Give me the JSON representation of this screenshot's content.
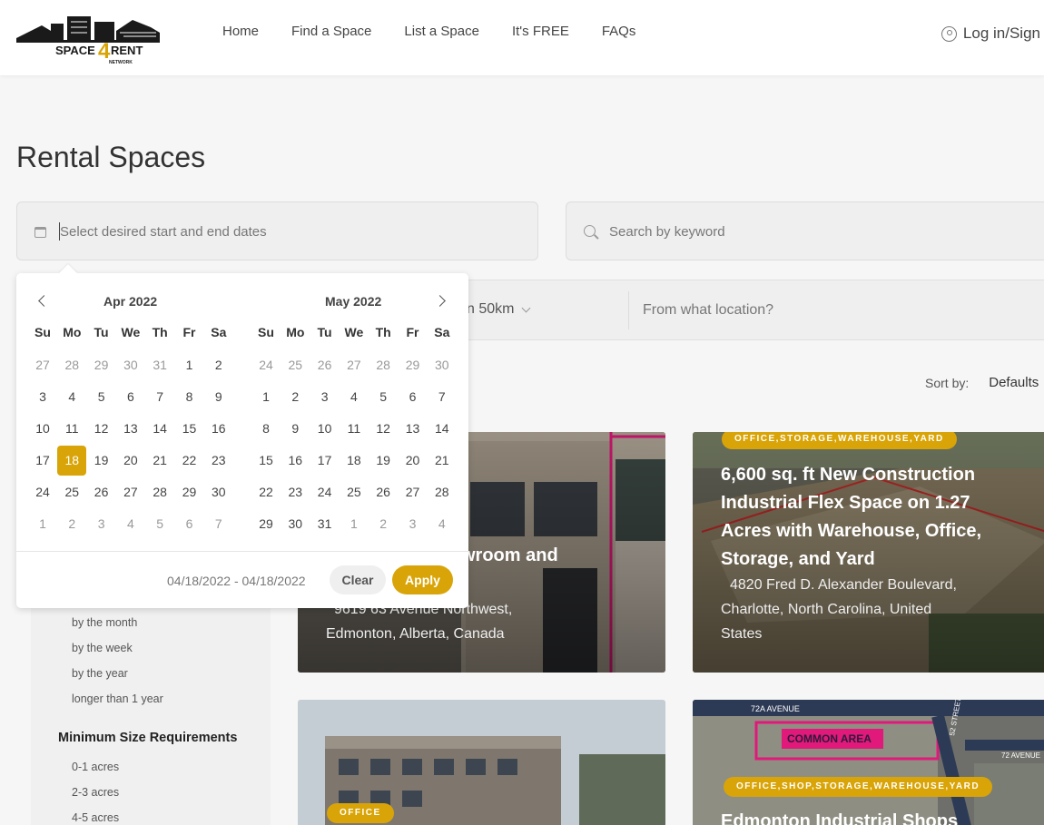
{
  "brand": {
    "name": "SPACE 4 RENT",
    "sub": "NETWORK",
    "accent": "#d9a407"
  },
  "nav": [
    {
      "label": "Home"
    },
    {
      "label": "Find a Space"
    },
    {
      "label": "List a Space"
    },
    {
      "label": "It's FREE"
    },
    {
      "label": "FAQs"
    }
  ],
  "login_label": "Log in/Sign",
  "page_title": "Rental Spaces",
  "date_field": {
    "placeholder": "Select desired start and end dates"
  },
  "search": {
    "placeholder": "Search by keyword"
  },
  "filters": {
    "radius": "n 50km",
    "location_placeholder": "From what location?"
  },
  "sort": {
    "label": "Sort by:",
    "value": "Defaults"
  },
  "calendar": {
    "weekdays": [
      "Su",
      "Mo",
      "Tu",
      "We",
      "Th",
      "Fr",
      "Sa"
    ],
    "months": [
      {
        "title": "Apr 2022",
        "weeks": [
          [
            "27",
            "28",
            "29",
            "30",
            "31",
            "1",
            "2"
          ],
          [
            "3",
            "4",
            "5",
            "6",
            "7",
            "8",
            "9"
          ],
          [
            "10",
            "11",
            "12",
            "13",
            "14",
            "15",
            "16"
          ],
          [
            "17",
            "18",
            "19",
            "20",
            "21",
            "22",
            "23"
          ],
          [
            "24",
            "25",
            "26",
            "27",
            "28",
            "29",
            "30"
          ],
          [
            "1",
            "2",
            "3",
            "4",
            "5",
            "6",
            "7"
          ]
        ],
        "selected": "18"
      },
      {
        "title": "May 2022",
        "weeks": [
          [
            "24",
            "25",
            "26",
            "27",
            "28",
            "29",
            "30"
          ],
          [
            "1",
            "2",
            "3",
            "4",
            "5",
            "6",
            "7"
          ],
          [
            "8",
            "9",
            "10",
            "11",
            "12",
            "13",
            "14"
          ],
          [
            "15",
            "16",
            "17",
            "18",
            "19",
            "20",
            "21"
          ],
          [
            "22",
            "23",
            "24",
            "25",
            "26",
            "27",
            "28"
          ],
          [
            "29",
            "30",
            "31",
            "1",
            "2",
            "3",
            "4"
          ]
        ],
        "selected": ""
      }
    ],
    "range_text": "04/18/2022 - 04/18/2022",
    "clear_label": "Clear",
    "apply_label": "Apply"
  },
  "sidebar": {
    "duration_options": [
      "by the month",
      "by the week",
      "by the year",
      "longer than 1 year"
    ],
    "size_heading": "Minimum Size Requirements",
    "size_options": [
      "0-1 acres",
      "2-3 acres",
      "4-5 acres"
    ]
  },
  "listings": [
    {
      "title": "wroom and",
      "address_line1": "9619 63 Avenue Northwest,",
      "address_line2": "Edmonton, Alberta, Canada",
      "badge": ""
    },
    {
      "badge": "OFFICE,STORAGE,WAREHOUSE,YARD",
      "title_lines": [
        "6,600 sq. ft New Construction",
        "Industrial Flex Space on 1.27",
        "Acres with Warehouse, Office,",
        "Storage, and Yard"
      ],
      "address_lines": [
        "4820 Fred D. Alexander Boulevard,",
        "Charlotte, North Carolina, United",
        "States"
      ]
    },
    {
      "badge": "OFFICE"
    },
    {
      "badge": "OFFICE,SHOP,STORAGE,WAREHOUSE,YARD",
      "title": "Edmonton Industrial Shops",
      "map_labels": [
        "72A AVENUE",
        "COMMON AREA",
        "72 AVENUE",
        "52 STREET"
      ]
    }
  ]
}
